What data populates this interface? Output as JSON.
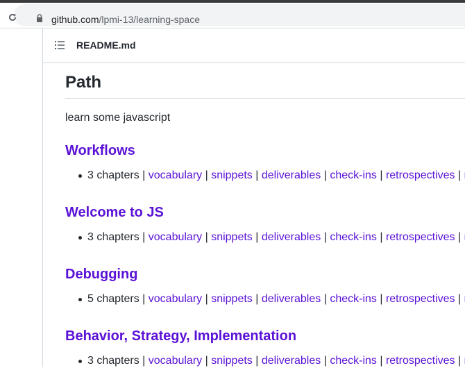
{
  "browser": {
    "url_host": "github.com",
    "url_path": "/lpmi-13/learning-space"
  },
  "file": {
    "name": "README.md"
  },
  "readme": {
    "title": "Path",
    "intro": "learn some javascript",
    "sections": [
      {
        "heading": "Workflows",
        "chapters": "3 chapters |",
        "links": [
          "vocabulary",
          "snippets",
          "deliverables",
          "check-ins",
          "retrospectives"
        ]
      },
      {
        "heading": "Welcome to JS",
        "chapters": "3 chapters |",
        "links": [
          "vocabulary",
          "snippets",
          "deliverables",
          "check-ins",
          "retrospectives"
        ]
      },
      {
        "heading": "Debugging",
        "chapters": "5 chapters |",
        "links": [
          "vocabulary",
          "snippets",
          "deliverables",
          "check-ins",
          "retrospectives"
        ]
      },
      {
        "heading": "Behavior, Strategy, Implementation",
        "chapters": "3 chapters |",
        "links": [
          "vocabulary",
          "snippets",
          "deliverables",
          "check-ins",
          "retrospectives"
        ]
      }
    ],
    "separator": "|",
    "truncated_tail": "r"
  },
  "colors": {
    "link": "#5a11d6",
    "text": "#24292f",
    "border": "#d0d7de"
  },
  "icons": [
    "reload-icon",
    "lock-icon",
    "list-icon"
  ]
}
